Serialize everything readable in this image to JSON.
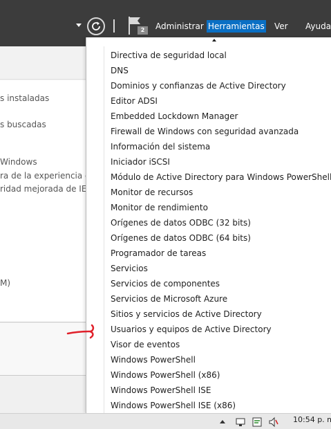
{
  "header": {
    "menu": [
      "Administrar",
      "Herramientas",
      "Ver",
      "Ayuda"
    ],
    "notification_count": "2",
    "active_menu": "Herramientas",
    "accent_color": "#0a6fc4"
  },
  "left_panel": {
    "lines": [
      "s instaladas",
      "s buscadas",
      "Windows",
      "ra de la experiencia del",
      "ridad mejorada de IE",
      "M)"
    ]
  },
  "tools_menu": {
    "items": [
      "Directiva de seguridad local",
      "DNS",
      "Dominios y confianzas de Active Directory",
      "Editor ADSI",
      "Embedded Lockdown Manager",
      "Firewall de Windows con seguridad avanzada",
      "Información del sistema",
      "Iniciador iSCSI",
      "Módulo de Active Directory para Windows PowerShell",
      "Monitor de recursos",
      "Monitor de rendimiento",
      "Orígenes de datos ODBC (32 bits)",
      "Orígenes de datos ODBC (64 bits)",
      "Programador de tareas",
      "Servicios",
      "Servicios de componentes",
      "Servicios de Microsoft Azure",
      "Sitios y servicios de Active Directory",
      "Usuarios y equipos de Active Directory",
      "Visor de eventos",
      "Windows PowerShell",
      "Windows PowerShell (x86)",
      "Windows PowerShell ISE",
      "Windows PowerShell ISE (x86)"
    ],
    "annotation_color": "#e0202a"
  },
  "taskbar": {
    "clock": "10:54 p. m.",
    "tray_icons": [
      "network-icon",
      "action-center-icon",
      "volume-icon"
    ]
  }
}
